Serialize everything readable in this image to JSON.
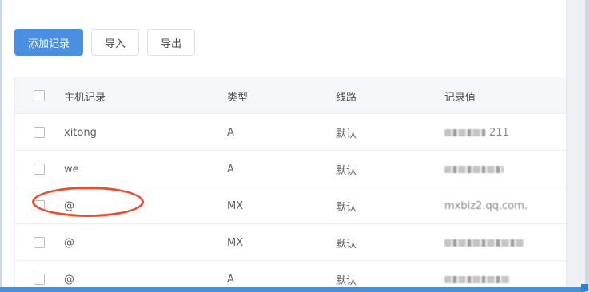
{
  "toolbar": {
    "add_label": "添加记录",
    "import_label": "导入",
    "export_label": "导出"
  },
  "table": {
    "headers": {
      "host": "主机记录",
      "type": "类型",
      "line": "线路",
      "value": "记录值"
    },
    "rows": [
      {
        "host": "xitong",
        "type": "A",
        "line": "默认",
        "value_visible": "211"
      },
      {
        "host": "we",
        "type": "A",
        "line": "默认",
        "value_visible": ""
      },
      {
        "host": "@",
        "type": "MX",
        "line": "默认",
        "value_visible": "mxbiz2.qq.com."
      },
      {
        "host": "@",
        "type": "MX",
        "line": "默认",
        "value_visible": ""
      },
      {
        "host": "@",
        "type": "A",
        "line": "默认",
        "value_visible": ""
      }
    ]
  },
  "colors": {
    "primary": "#4a8fe0",
    "annotation": "#f04a2a"
  }
}
